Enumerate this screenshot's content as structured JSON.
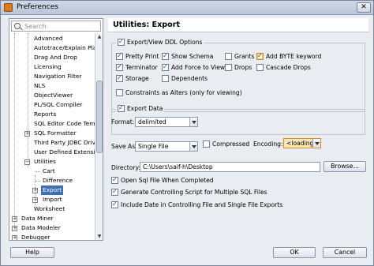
{
  "window": {
    "title": "Preferences",
    "close_glyph": "✕"
  },
  "search": {
    "placeholder": "Search"
  },
  "tree": [
    {
      "label": "Advanced"
    },
    {
      "label": "Autotrace/Explain Plan"
    },
    {
      "label": "Drag And Drop"
    },
    {
      "label": "Licensing"
    },
    {
      "label": "Navigation Filter"
    },
    {
      "label": "NLS"
    },
    {
      "label": "ObjectViewer"
    },
    {
      "label": "PL/SQL Compiler"
    },
    {
      "label": "Reports"
    },
    {
      "label": "SQL Editor Code Templates"
    },
    {
      "label": "SQL Formatter"
    },
    {
      "label": "Third Party JDBC Drivers"
    },
    {
      "label": "User Defined Extensions"
    },
    {
      "label": "Utilities"
    },
    {
      "label": "Cart"
    },
    {
      "label": "Difference"
    },
    {
      "label": "Export"
    },
    {
      "label": "Import"
    },
    {
      "label": "Worksheet"
    },
    {
      "label": "Data Miner"
    },
    {
      "label": "Data Modeler"
    },
    {
      "label": "Debugger"
    }
  ],
  "panel": {
    "title": "Utilities: Export",
    "ddl_group": {
      "label": "Export/View DDL Options",
      "checked": true,
      "options": [
        {
          "label": "Pretty Print",
          "checked": true
        },
        {
          "label": "Show Schema",
          "checked": true
        },
        {
          "label": "Grants",
          "checked": false
        },
        {
          "label": "Add BYTE keyword",
          "checked": true
        },
        {
          "label": "Terminator",
          "checked": true
        },
        {
          "label": "Add Force to Views",
          "checked": true
        },
        {
          "label": "Drops",
          "checked": false
        },
        {
          "label": "Cascade Drops",
          "checked": false
        },
        {
          "label": "Storage",
          "checked": true
        },
        {
          "label": "Dependents",
          "checked": false
        }
      ],
      "constraints": {
        "label": "Constraints as Alters (only for viewing)",
        "checked": false
      }
    },
    "data_group": {
      "label": "Export Data",
      "checked": true,
      "format_label": "Format:",
      "format_value": "delimited"
    },
    "save_as": {
      "label": "Save As",
      "value": "Single File"
    },
    "compressed": {
      "label": "Compressed",
      "checked": false
    },
    "encoding": {
      "label": "Encoding:",
      "value": "<loading>"
    },
    "directory": {
      "label": "Directory:",
      "value": "C:\\Users\\saif-h\\Desktop",
      "browse": "Browse..."
    },
    "open_sql": {
      "label": "Open Sql File When Completed",
      "checked": true
    },
    "gen_script": {
      "label": "Generate Controlling Script for Multiple SQL Files",
      "checked": true
    },
    "include_date": {
      "label": "Include Date in Controlling File and Single File Exports",
      "checked": true
    }
  },
  "footer": {
    "help": "Help",
    "ok": "OK",
    "cancel": "Cancel"
  }
}
